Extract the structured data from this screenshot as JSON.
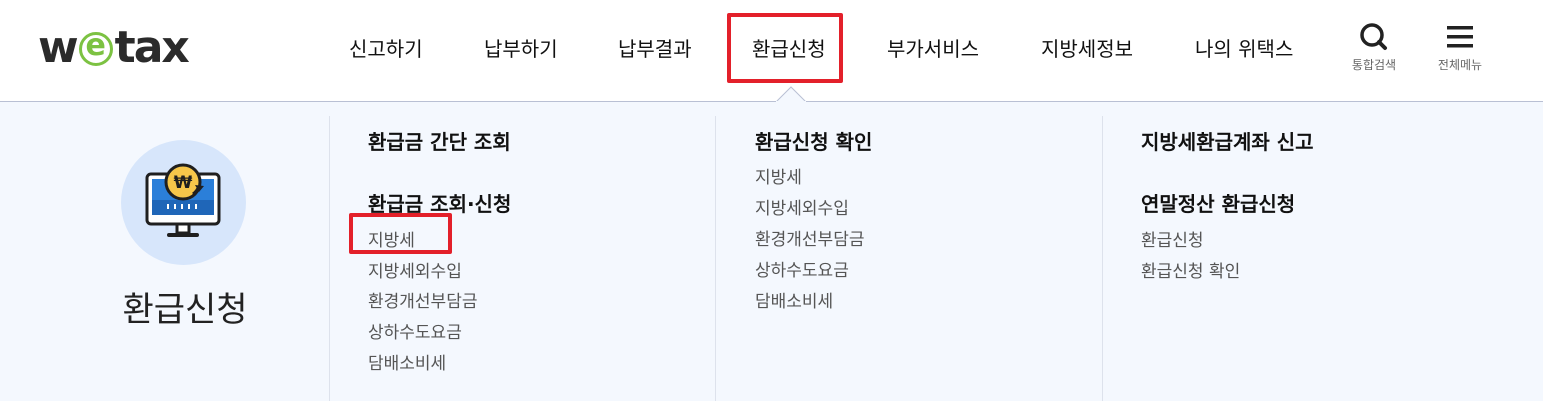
{
  "logo": {
    "pre": "w",
    "e": "e",
    "post": "tax"
  },
  "gnb": [
    {
      "label": "신고하기"
    },
    {
      "label": "납부하기"
    },
    {
      "label": "납부결과"
    },
    {
      "label": "환급신청"
    },
    {
      "label": "부가서비스"
    },
    {
      "label": "지방세정보"
    },
    {
      "label": "나의 위택스"
    }
  ],
  "util": {
    "search_label": "통합검색",
    "menu_label": "전체메뉴"
  },
  "panel": {
    "side_title": "환급신청",
    "col1": {
      "heading1": "환급금 간단 조회",
      "heading2": "환급금 조회·신청",
      "items": [
        "지방세",
        "지방세외수입",
        "환경개선부담금",
        "상하수도요금",
        "담배소비세"
      ]
    },
    "col2": {
      "heading": "환급신청 확인",
      "items": [
        "지방세",
        "지방세외수입",
        "환경개선부담금",
        "상하수도요금",
        "담배소비세"
      ]
    },
    "col3": {
      "heading1": "지방세환급계좌 신고",
      "heading2": "연말정산 환급신청",
      "items": [
        "환급신청",
        "환급신청 확인"
      ]
    }
  },
  "colors": {
    "highlight": "#e3202a",
    "logo_green": "#7cc242",
    "panel_bg": "#f4f8fe",
    "icon_bg": "#d7e6fb",
    "coin": "#f6c64a",
    "monitor": "#2b7fd9"
  },
  "icons": {
    "search": "search-icon",
    "menu": "hamburger-menu-icon",
    "side": "monitor-won-refund-icon"
  }
}
